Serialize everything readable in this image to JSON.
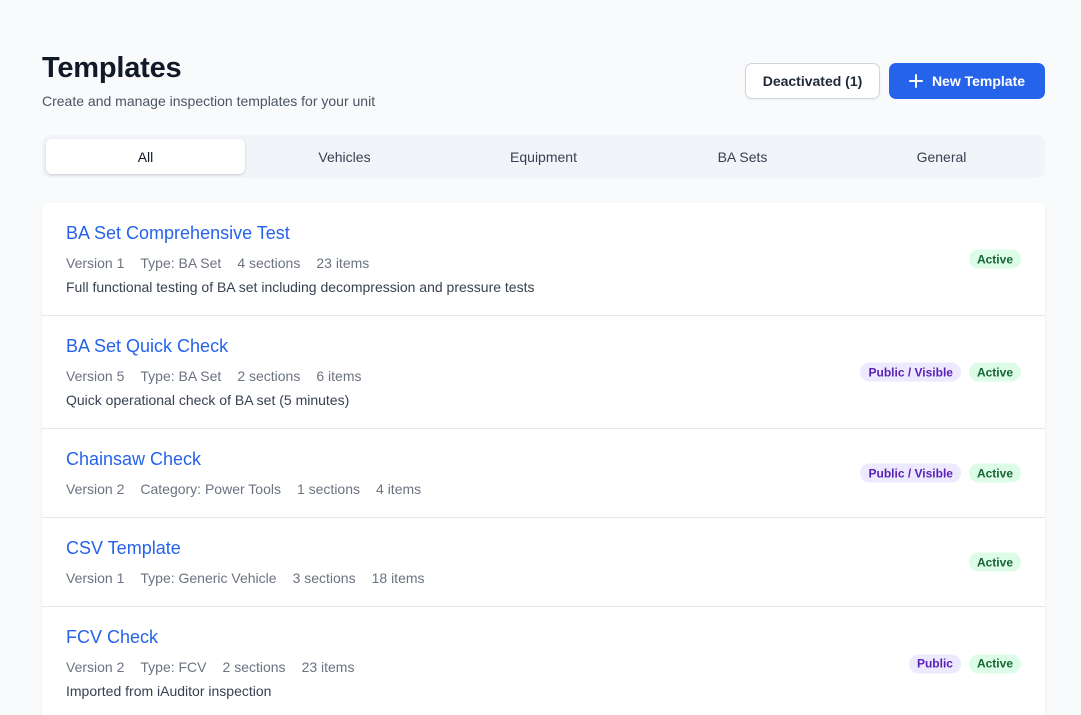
{
  "header": {
    "title": "Templates",
    "subtitle": "Create and manage inspection templates for your unit",
    "deactivated_label": "Deactivated (1)",
    "new_template_label": "New Template"
  },
  "tabs": [
    {
      "label": "All",
      "active": true
    },
    {
      "label": "Vehicles",
      "active": false
    },
    {
      "label": "Equipment",
      "active": false
    },
    {
      "label": "BA Sets",
      "active": false
    },
    {
      "label": "General",
      "active": false
    }
  ],
  "templates": [
    {
      "title": "BA Set Comprehensive Test",
      "version": "Version 1",
      "type": "Type: BA Set",
      "sections": "4 sections",
      "items": "23 items",
      "description": "Full functional testing of BA set including decompression and pressure tests",
      "visibility_badge": "",
      "status_badge": "Active"
    },
    {
      "title": "BA Set Quick Check",
      "version": "Version 5",
      "type": "Type: BA Set",
      "sections": "2 sections",
      "items": "6 items",
      "description": "Quick operational check of BA set (5 minutes)",
      "visibility_badge": "Public / Visible",
      "status_badge": "Active"
    },
    {
      "title": "Chainsaw Check",
      "version": "Version 2",
      "type": "Category: Power Tools",
      "sections": "1 sections",
      "items": "4 items",
      "description": "",
      "visibility_badge": "Public / Visible",
      "status_badge": "Active"
    },
    {
      "title": "CSV Template",
      "version": "Version 1",
      "type": "Type: Generic Vehicle",
      "sections": "3 sections",
      "items": "18 items",
      "description": "",
      "visibility_badge": "",
      "status_badge": "Active"
    },
    {
      "title": "FCV Check",
      "version": "Version 2",
      "type": "Type: FCV",
      "sections": "2 sections",
      "items": "23 items",
      "description": "Imported from iAuditor inspection",
      "visibility_badge": "Public",
      "status_badge": "Active"
    }
  ],
  "colors": {
    "accent": "#2563eb",
    "active_badge_bg": "#dcfce7",
    "public_badge_bg": "#ede9fe"
  }
}
